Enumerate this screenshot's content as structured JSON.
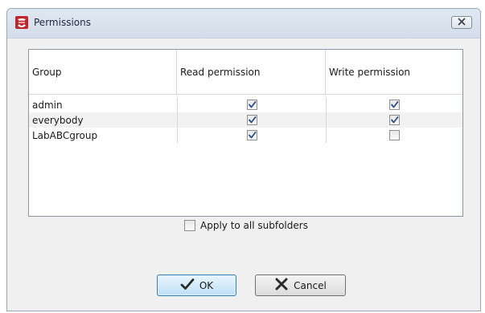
{
  "dialog": {
    "title": "Permissions",
    "icon": "app-logo-icon",
    "close_icon": "close-x-icon"
  },
  "table": {
    "headers": {
      "group": "Group",
      "read": "Read permission",
      "write": "Write permission"
    },
    "rows": [
      {
        "group": "admin",
        "read": true,
        "write": true
      },
      {
        "group": "everybody",
        "read": true,
        "write": true
      },
      {
        "group": "LabABCgroup",
        "read": true,
        "write": false
      }
    ]
  },
  "subfolders": {
    "label": "Apply to all subfolders",
    "checked": false
  },
  "buttons": {
    "ok": {
      "label": "OK",
      "icon": "checkmark-icon"
    },
    "cancel": {
      "label": "Cancel",
      "icon": "cross-icon"
    }
  },
  "colors": {
    "accent": "#3c7fb1",
    "check": "#2a4f86",
    "app_icon": "#c0272d"
  }
}
